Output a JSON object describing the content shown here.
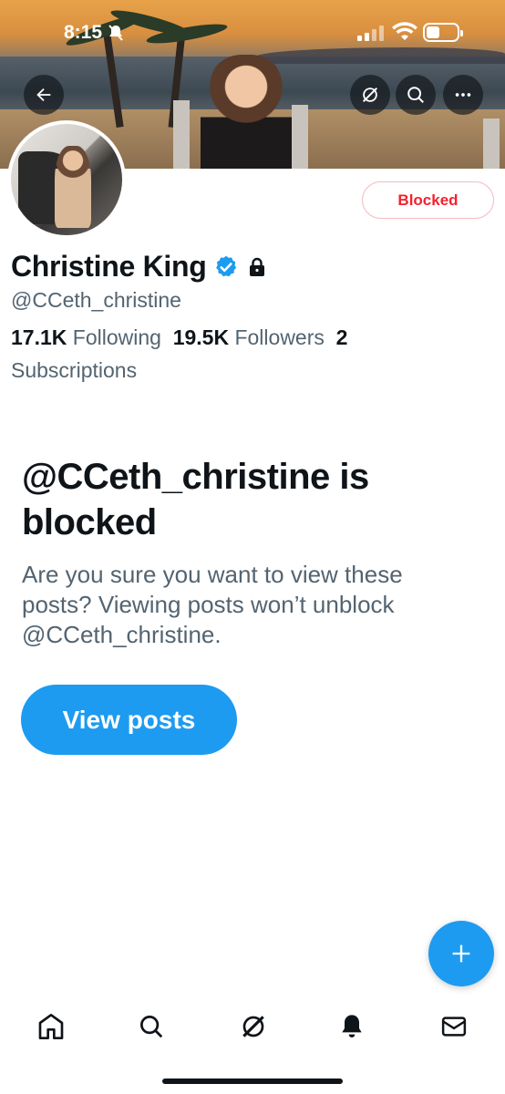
{
  "status_bar": {
    "time": "8:15"
  },
  "header": {
    "back_icon": "arrow-left-icon",
    "grok_icon": "grok-icon",
    "search_icon": "search-icon",
    "more_icon": "more-horizontal-icon"
  },
  "profile": {
    "name": "Christine King",
    "handle": "@CCeth_christine",
    "relationship_button": "Blocked",
    "following_count": "17.1K",
    "following_label": "Following",
    "followers_count": "19.5K",
    "followers_label": "Followers",
    "subscriptions_count": "2",
    "subscriptions_label": "Subscriptions"
  },
  "blocked_notice": {
    "title": "@CCeth_christine is blocked",
    "description": "Are you sure you want to view these posts? Viewing posts won’t unblock @CCeth_christine.",
    "button_label": "View posts"
  },
  "colors": {
    "accent": "#1d9bf0",
    "blocked_red": "#f4212e",
    "secondary_text": "#536471"
  },
  "bottom_nav": [
    {
      "icon": "home-icon"
    },
    {
      "icon": "search-icon"
    },
    {
      "icon": "grok-icon"
    },
    {
      "icon": "bell-icon"
    },
    {
      "icon": "mail-icon"
    }
  ]
}
